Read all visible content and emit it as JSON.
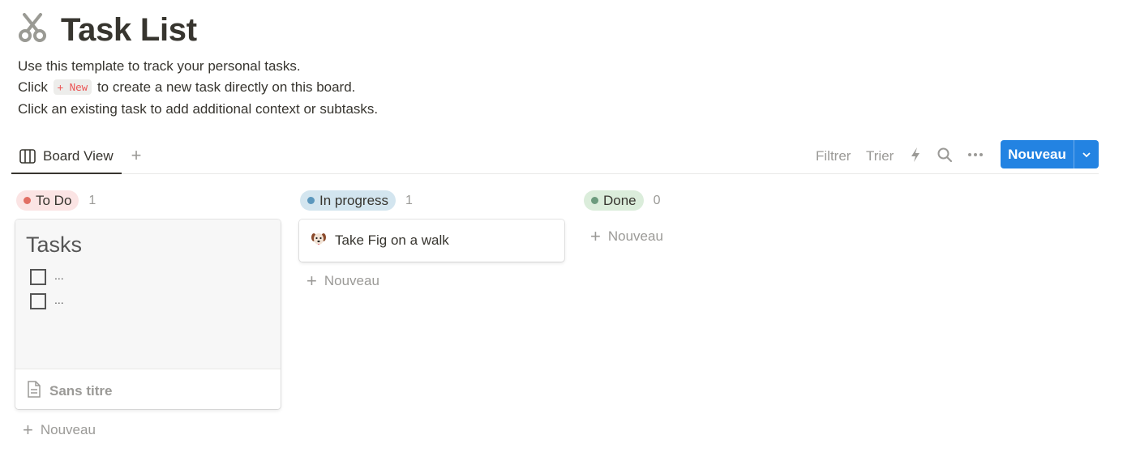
{
  "page": {
    "icon": "scissors-icon",
    "title": "Task List",
    "description": [
      "Use this template to track your personal tasks.",
      {
        "before": "Click",
        "chip": "+ New",
        "after": "to create a new task directly on this board."
      },
      "Click an existing task to add additional context or subtasks."
    ]
  },
  "views": {
    "tabs": [
      {
        "label": "Board View",
        "icon": "board-view-icon"
      }
    ],
    "add_icon": "plus-icon"
  },
  "toolbar": {
    "filter_label": "Filtrer",
    "sort_label": "Trier",
    "automation_icon": "lightning-icon",
    "search_icon": "search-icon",
    "more_icon": "more-horizontal-icon",
    "new_label": "Nouveau",
    "new_dropdown_icon": "chevron-down-icon",
    "accent_color": "#2383e2"
  },
  "board": {
    "groups": [
      {
        "label": "To Do",
        "count": "1",
        "pill_color": "#fbe4e4",
        "dot_color": "#e16f64",
        "cards": [
          {
            "cover_title": "Tasks",
            "cover_items": [
              "...",
              "..."
            ],
            "title": "Sans titre",
            "icon": "page-icon"
          }
        ],
        "add_label": "Nouveau"
      },
      {
        "label": "In progress",
        "count": "1",
        "pill_color": "#d3e5ef",
        "dot_color": "#5b97bd",
        "cards": [
          {
            "title": "Take Fig on a walk",
            "icon": "dog-icon"
          }
        ],
        "add_label": "Nouveau"
      },
      {
        "label": "Done",
        "count": "0",
        "pill_color": "#dbeddb",
        "dot_color": "#6c9b7d",
        "cards": [],
        "add_label": "Nouveau"
      }
    ]
  }
}
